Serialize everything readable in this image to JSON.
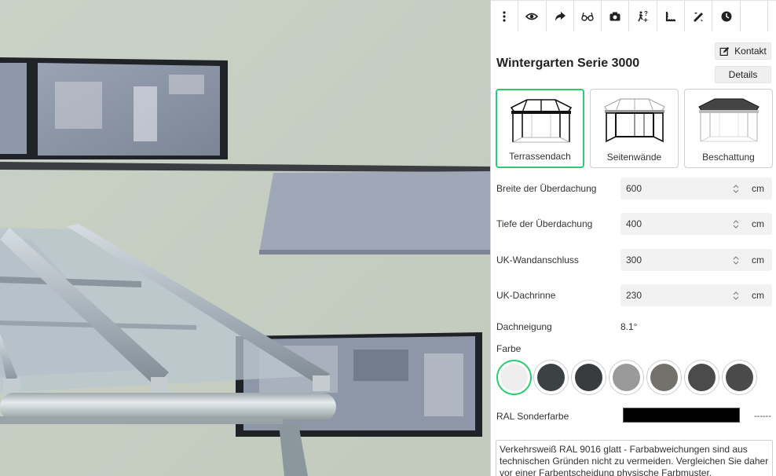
{
  "app": {
    "title": "Wintergarten Serie 3000",
    "contact_label": "Kontakt",
    "details_label": "Details"
  },
  "toolbar": {
    "buttons": [
      {
        "name": "menu-icon"
      },
      {
        "name": "eye-icon"
      },
      {
        "name": "share-icon"
      },
      {
        "name": "vr-glasses-icon"
      },
      {
        "name": "camera-icon"
      },
      {
        "name": "walk-help-icon"
      },
      {
        "name": "measure-icon"
      },
      {
        "name": "tools-icon"
      },
      {
        "name": "clock-icon"
      },
      {
        "name": "blank"
      },
      {
        "name": "close-icon"
      }
    ]
  },
  "modules": [
    {
      "label": "Terrassendach",
      "selected": true
    },
    {
      "label": "Seitenwände",
      "selected": false
    },
    {
      "label": "Beschattung",
      "selected": false
    }
  ],
  "fields": [
    {
      "label": "Breite der Überdachung",
      "value": "600",
      "unit": "cm"
    },
    {
      "label": "Tiefe der Überdachung",
      "value": "400",
      "unit": "cm"
    },
    {
      "label": "UK-Wandanschluss",
      "value": "300",
      "unit": "cm"
    },
    {
      "label": "UK-Dachrinne",
      "value": "230",
      "unit": "cm"
    }
  ],
  "roof_pitch": {
    "label": "Dachneigung",
    "value": "8.1°"
  },
  "color": {
    "label": "Farbe",
    "swatches": [
      {
        "hex": "#eeeeee",
        "selected": true
      },
      {
        "hex": "#3c4144",
        "selected": false
      },
      {
        "hex": "#383c3f",
        "selected": false
      },
      {
        "hex": "#9a9a9a",
        "selected": false
      },
      {
        "hex": "#72716b",
        "selected": false
      },
      {
        "hex": "#4b4b4b",
        "selected": false
      },
      {
        "hex": "#4a4a4a",
        "selected": false
      }
    ]
  },
  "ral": {
    "label": "RAL Sonderfarbe",
    "value_text": "------",
    "box_color": "#000000"
  },
  "description": "Verkehrsweiß RAL 9016 glatt - Farbabweichungen sind aus technischen Gründen nicht zu vermeiden. Vergleichen Sie daher vor einer Farbentscheidung physische Farbmuster.",
  "colors": {
    "accent": "#2ecc71",
    "wall": "#c9d1c6"
  }
}
